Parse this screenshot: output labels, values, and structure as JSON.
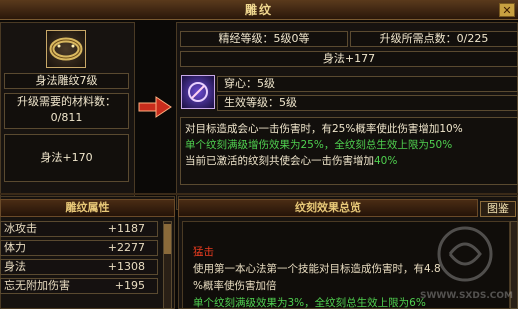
{
  "window": {
    "title": "雕纹"
  },
  "item": {
    "name": "身法雕纹7级",
    "materials_label": "升级需要的材料数：",
    "materials_value": "0/811",
    "stat": "身法+170"
  },
  "upgrade": {
    "refine_level": "精经等级：5级0等",
    "points_needed": "升级所需点数：0/225",
    "stat": "身法+177"
  },
  "effect": {
    "name": "穿心：5级",
    "active_level": "生效等级：5级",
    "line1": "对目标造成会心一击伤害时，有25%概率使此伤害增加10%",
    "line2": "单个纹刻满级增伤效果为25%，全纹刻总生效上限为50%",
    "line3_prefix": "当前已激活的纹刻共使会心一击伤害增加",
    "line3_value": "40%"
  },
  "attributes": {
    "title": "雕纹属性",
    "rows": [
      {
        "name": "冰攻击",
        "value": "+1187"
      },
      {
        "name": "体力",
        "value": "+2277"
      },
      {
        "name": "身法",
        "value": "+1308"
      },
      {
        "name": "忘无附加伤害",
        "value": "+195"
      }
    ]
  },
  "overview": {
    "title": "纹刻效果总览",
    "tab": "图鉴",
    "entry_name": "猛击",
    "entry_line1": "使用第一本心法第一个技能对目标造成伤害时，有4.8",
    "entry_line2": "%概率使伤害加倍",
    "entry_line3": "单个纹刻满级效果为3%，全纹刻总生效上限为6%"
  },
  "watermark": {
    "text": "SWWW.SXDS.COM"
  },
  "colors": {
    "accent": "#f0d890",
    "green": "#4fd04f",
    "red": "#e83c20"
  }
}
